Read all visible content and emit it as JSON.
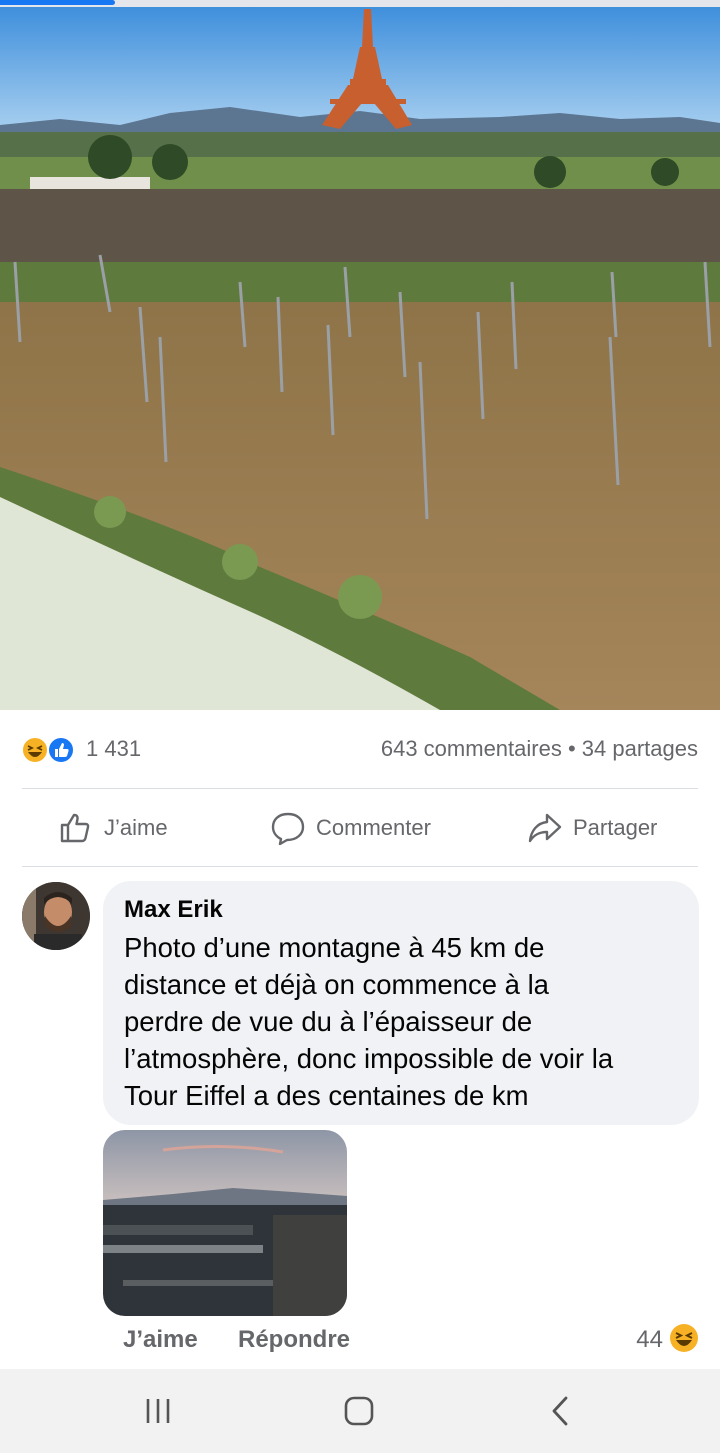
{
  "reactions": {
    "icons": [
      "haha-emoji-icon",
      "like-thumb-icon"
    ],
    "count": "1 431"
  },
  "stats": {
    "comments": "643 commentaires",
    "separator": "•",
    "shares": "34 partages"
  },
  "actions": {
    "like_label": "J’aime",
    "comment_label": "Commenter",
    "share_label": "Partager"
  },
  "comment": {
    "author": "Max Erik",
    "lines": [
      "Photo d’une montagne à 45 km de",
      "distance et déjà on commence à la",
      "perdre de vue du à l’épaisseur de",
      "l’atmosphère, donc impossible de voir la",
      "Tour Eiffel a des centaines de km"
    ],
    "like_label": "J’aime",
    "reply_label": "Répondre",
    "reaction_count": "44",
    "reaction_icon": "haha-emoji-icon"
  },
  "navigation": {
    "buttons": [
      "recent-apps-icon",
      "home-icon",
      "back-icon"
    ]
  },
  "colors": {
    "accent": "#1877f2",
    "text_secondary": "#65676b",
    "bubble_bg": "#f0f2f5"
  }
}
